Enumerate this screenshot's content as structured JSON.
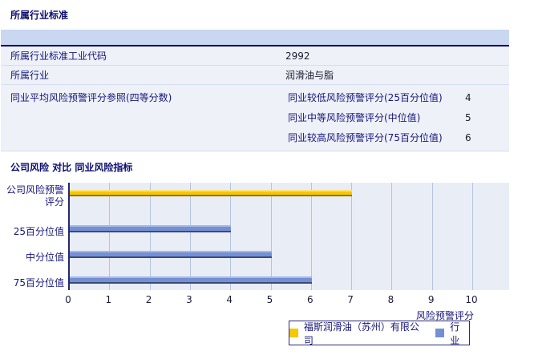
{
  "colors": {
    "accent_navy": "#000066",
    "table_header_bg": "#c9d7f0",
    "row_bg": "#eef1f8",
    "plot_bg": "#e9edf6",
    "gridline": "#b3c4e4",
    "company_bar": "#f7c700",
    "industry_bar": "#7390d5"
  },
  "section1": {
    "title": "所属行业标准",
    "table": {
      "rows": [
        {
          "label": "所属行业标准工业代码",
          "value": "2992"
        },
        {
          "label": "所属行业",
          "value": "润滑油与脂"
        },
        {
          "label": "同业平均风险预警评分参照(四等分数)"
        }
      ],
      "subrows": [
        {
          "label": "同业较低风险预警评分(25百分位值)",
          "value": "4"
        },
        {
          "label": "同业中等风险预警评分(中位值)",
          "value": "5"
        },
        {
          "label": "同业较高风险预警评分(75百分位值)",
          "value": "6"
        }
      ]
    }
  },
  "section2": {
    "title": "公司风险 对比 同业风险指标"
  },
  "chart_data": {
    "type": "bar",
    "orientation": "horizontal",
    "categories": [
      "公司风险预警评分",
      "25百分位值",
      "中分位值",
      "75百分位值"
    ],
    "category_display": [
      "公司风险预警<br>评分",
      "25百分位值",
      "中分位值",
      "75百分位值"
    ],
    "values": [
      7,
      4,
      5,
      6
    ],
    "bar_colors": [
      "#f7c700",
      "#7390d5",
      "#7390d5",
      "#7390d5"
    ],
    "xlabel": "风险预警评分",
    "xlim": [
      0,
      10
    ],
    "xticks": [
      "0",
      "1",
      "2",
      "3",
      "4",
      "5",
      "6",
      "7",
      "8",
      "9",
      "10"
    ],
    "grid": true,
    "legend_position": "bottom",
    "legend": [
      {
        "label": "福斯润滑油（苏州）有限公司",
        "color": "#f7c700",
        "kind": "company"
      },
      {
        "label": "行业",
        "color": "#7390d5",
        "kind": "industry"
      }
    ]
  }
}
